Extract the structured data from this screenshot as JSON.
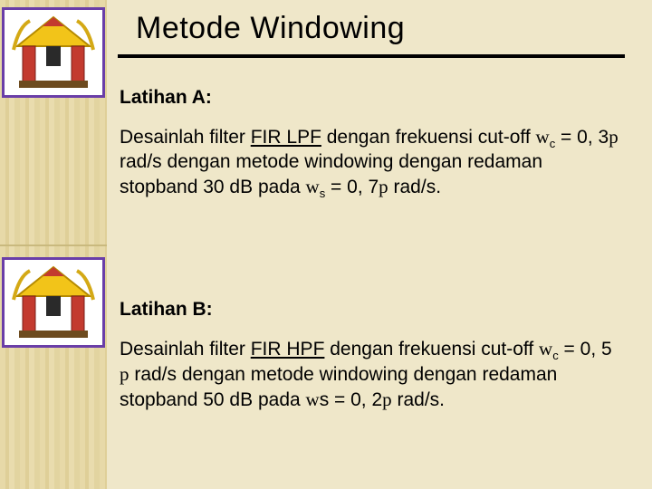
{
  "title": "Metode Windowing",
  "icon_name_top": "temple-gate-icon",
  "icon_name_bot": "temple-gate-icon",
  "sectionA": {
    "heading": "Latihan A:",
    "text_lead": "Desainlah filter ",
    "text_link": "FIR LPF",
    "text_2": " dengan frekuensi cut-off  ",
    "wc_sub": "c",
    "wc_val": " = 0, 3",
    "text_3": " rad/s dengan metode windowing dengan redaman stopband 30 dB pada ",
    "ws_sub": "s",
    "ws_val": " = 0, 7",
    "text_end": " rad/s."
  },
  "sectionB": {
    "heading": "Latihan B:",
    "text_lead": "Desainlah filter ",
    "text_link": "FIR HPF",
    "text_2": " dengan frekuensi cut-off  ",
    "wc_sub": "c",
    "wc_val": " = 0, 5 ",
    "text_3": " rad/s dengan metode windowing dengan redaman stopband 50 dB pada ",
    "ws_sub": "s",
    "ws_val": " = 0, 2",
    "text_end": " rad/s."
  },
  "greek": {
    "omega": "w",
    "pi": "p"
  }
}
